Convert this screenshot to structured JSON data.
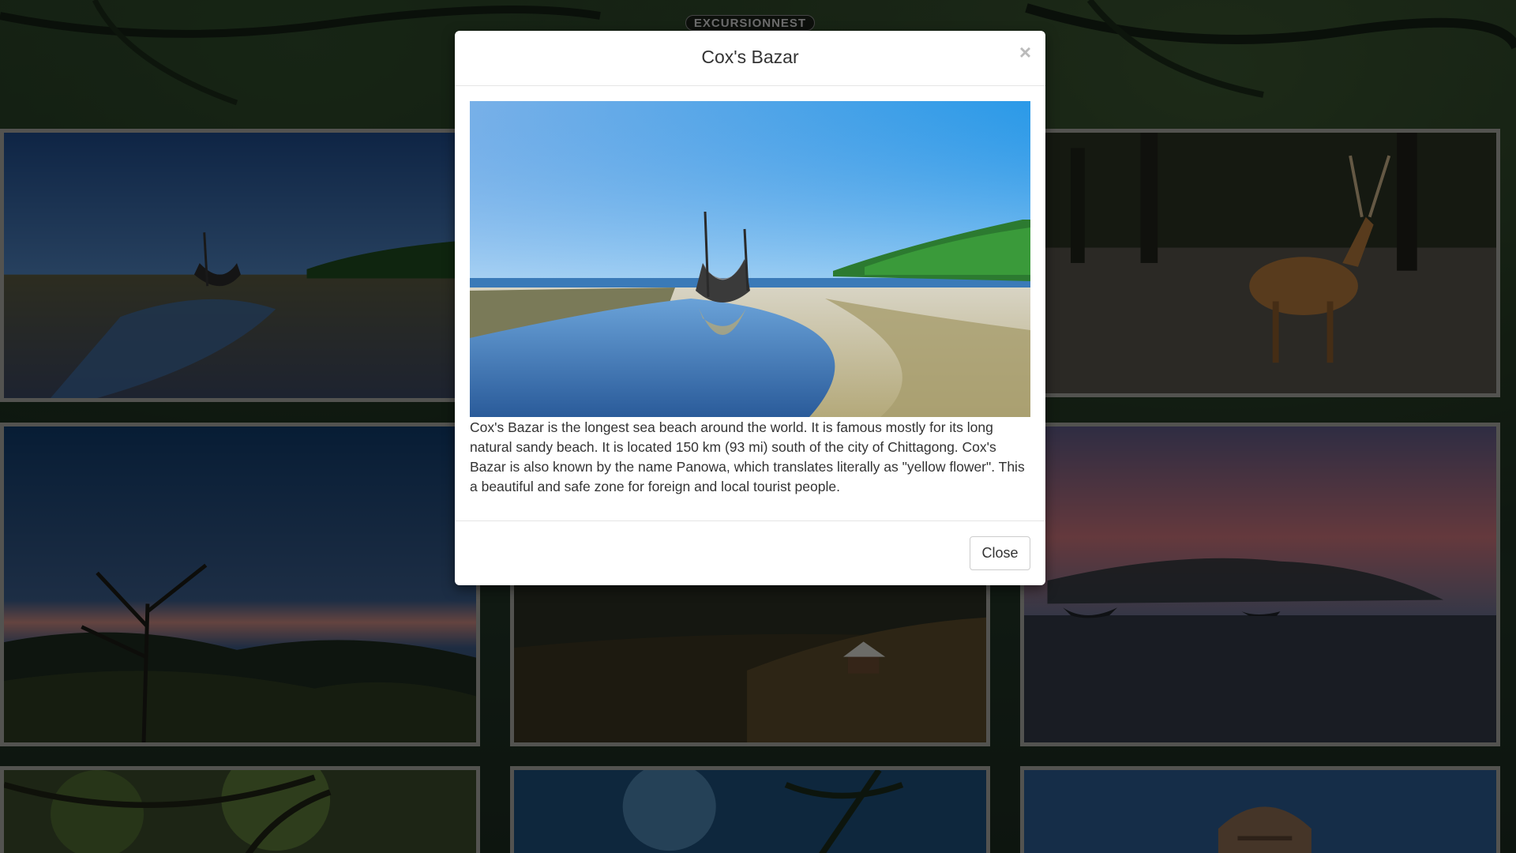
{
  "site": {
    "logo_text": "EXCURSIONNEST"
  },
  "gallery": {
    "cards": [
      {
        "name": "coxs-bazar",
        "scene": "beach-boat"
      },
      {
        "name": "sundarbans-deer",
        "scene": "forest-deer"
      },
      {
        "name": "hill-tree",
        "scene": "hill-dusk"
      },
      {
        "name": "valley-hut",
        "scene": "valley-hut"
      },
      {
        "name": "misty-beach",
        "scene": "misty-beach"
      },
      {
        "name": "forest-canopy",
        "scene": "forest-canopy"
      },
      {
        "name": "palm-sky",
        "scene": "palm-sky"
      },
      {
        "name": "old-tower",
        "scene": "old-tower"
      }
    ]
  },
  "modal": {
    "title": "Cox's Bazar",
    "close_symbol": "×",
    "description": "Cox's Bazar is the longest sea beach around the world. It is famous mostly for its long natural sandy beach. It is located 150 km (93 mi) south of the city of Chittagong. Cox's Bazar is also known by the name Panowa, which translates literally as \"yellow flower\". This a beautiful and safe zone for foreign and local tourist people.",
    "close_button_label": "Close",
    "image_alt": "Boat on Cox's Bazar beach"
  },
  "colors": {
    "card_border": "#a6a6a0",
    "backdrop": "rgba(0,0,0,0.5)",
    "modal_bg": "#ffffff"
  }
}
